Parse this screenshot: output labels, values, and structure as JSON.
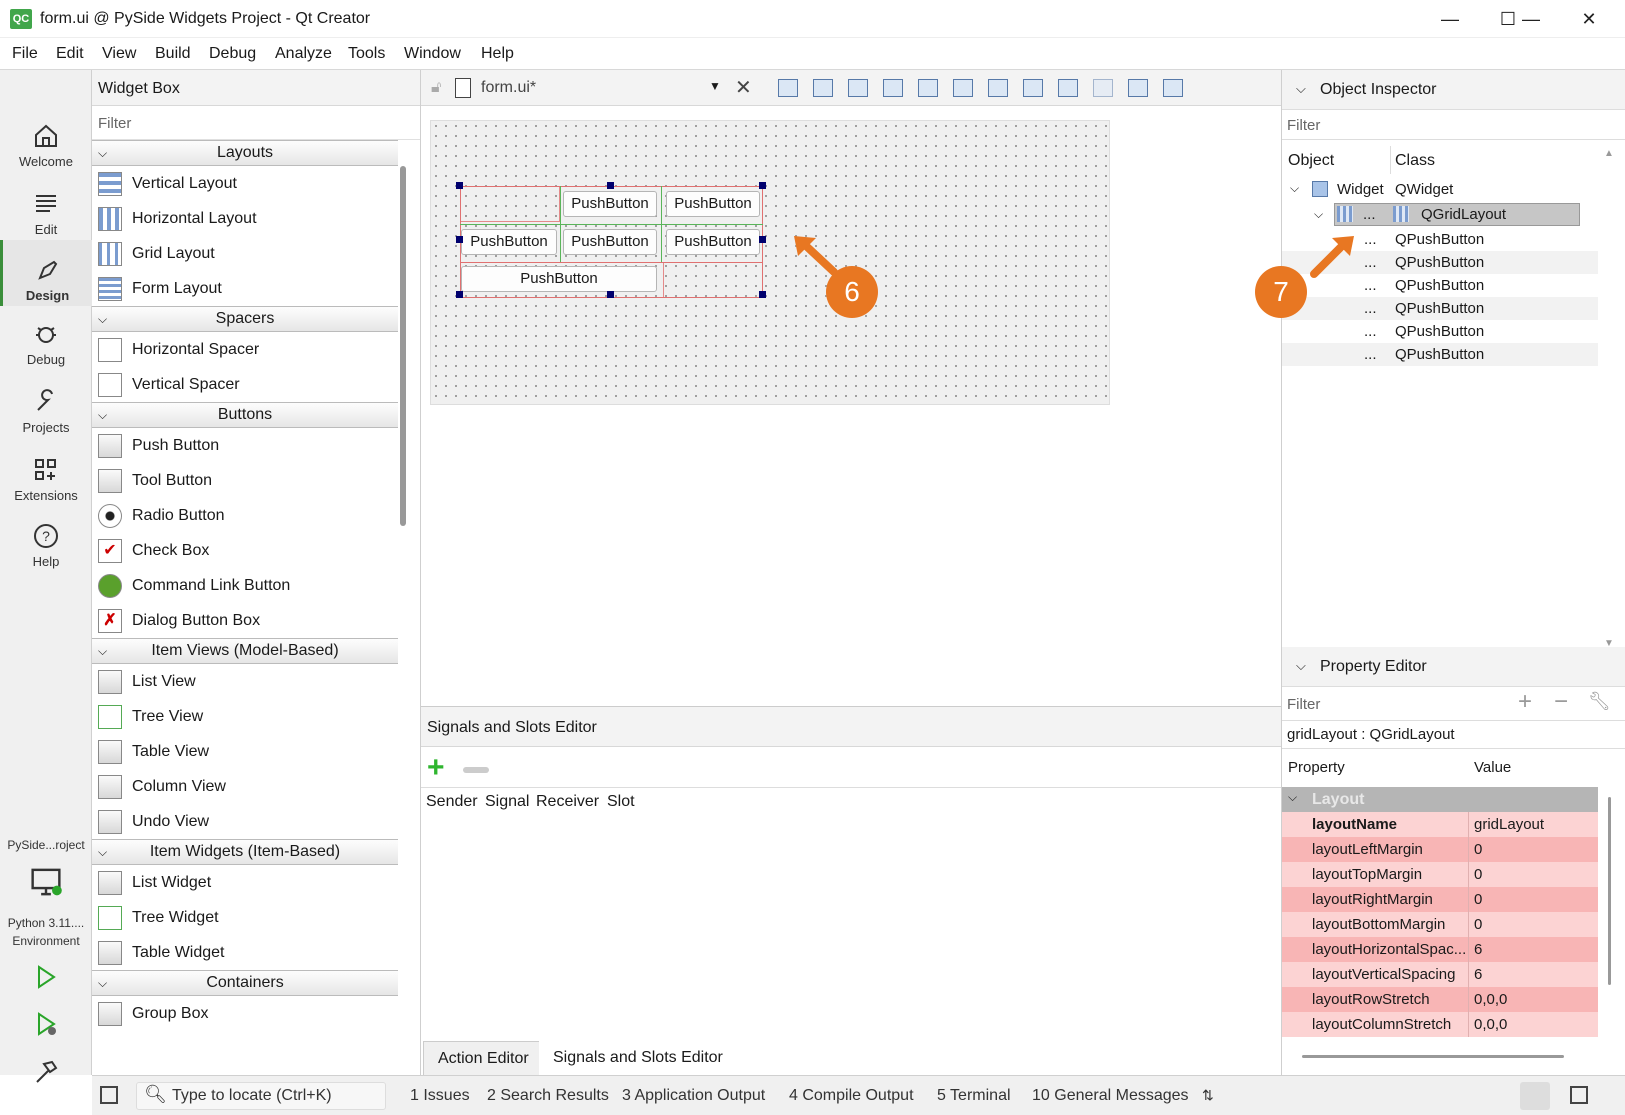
{
  "window": {
    "title": "form.ui @ PySide Widgets Project - Qt Creator",
    "logo": "QC",
    "minimize": "—",
    "maximize": "☐",
    "close": "✕"
  },
  "menu": [
    "File",
    "Edit",
    "View",
    "Build",
    "Debug",
    "Analyze",
    "Tools",
    "Window",
    "Help"
  ],
  "modes": {
    "welcome": "Welcome",
    "edit": "Edit",
    "design": "Design",
    "debug": "Debug",
    "projects": "Projects",
    "extensions": "Extensions",
    "help": "Help",
    "project_short": "PySide...roject",
    "env_line1": "Python 3.11....",
    "env_line2": "Environment"
  },
  "widget_box": {
    "title": "Widget Box",
    "filter": "Filter",
    "categories": [
      {
        "name": "Layouts",
        "items": [
          "Vertical Layout",
          "Horizontal Layout",
          "Grid Layout",
          "Form Layout"
        ]
      },
      {
        "name": "Spacers",
        "items": [
          "Horizontal Spacer",
          "Vertical Spacer"
        ]
      },
      {
        "name": "Buttons",
        "items": [
          "Push Button",
          "Tool Button",
          "Radio Button",
          "Check Box",
          "Command Link Button",
          "Dialog Button Box"
        ]
      },
      {
        "name": "Item Views (Model-Based)",
        "items": [
          "List View",
          "Tree View",
          "Table View",
          "Column View",
          "Undo View"
        ]
      },
      {
        "name": "Item Widgets (Item-Based)",
        "items": [
          "List Widget",
          "Tree Widget",
          "Table Widget"
        ]
      },
      {
        "name": "Containers",
        "items": [
          "Group Box"
        ]
      }
    ]
  },
  "editor": {
    "file": "form.ui*",
    "buttons": [
      "PushButton",
      "PushButton",
      "PushButton",
      "PushButton",
      "PushButton",
      "PushButton"
    ],
    "callout6": "6",
    "callout7": "7"
  },
  "signals": {
    "title": "Signals and Slots Editor",
    "columns": [
      "Sender",
      "Signal",
      "Receiver",
      "Slot"
    ],
    "tab_action": "Action Editor",
    "tab_signals": "Signals and Slots Editor"
  },
  "object_inspector": {
    "title": "Object Inspector",
    "filter": "Filter",
    "col_object": "Object",
    "col_class": "Class",
    "root_object": "Widget",
    "root_class": "QWidget",
    "layout_object": "...",
    "layout_class": "QGridLayout",
    "children": [
      {
        "object": "...",
        "class": "QPushButton"
      },
      {
        "object": "...",
        "class": "QPushButton"
      },
      {
        "object": "...",
        "class": "QPushButton"
      },
      {
        "object": "...",
        "class": "QPushButton"
      },
      {
        "object": "...",
        "class": "QPushButton"
      },
      {
        "object": "...",
        "class": "QPushButton"
      }
    ]
  },
  "property_editor": {
    "title": "Property Editor",
    "filter": "Filter",
    "current": "gridLayout : QGridLayout",
    "col_property": "Property",
    "col_value": "Value",
    "group": "Layout",
    "rows": [
      {
        "name": "layoutName",
        "value": "gridLayout"
      },
      {
        "name": "layoutLeftMargin",
        "value": "0"
      },
      {
        "name": "layoutTopMargin",
        "value": "0"
      },
      {
        "name": "layoutRightMargin",
        "value": "0"
      },
      {
        "name": "layoutBottomMargin",
        "value": "0"
      },
      {
        "name": "layoutHorizontalSpac...",
        "value": "6"
      },
      {
        "name": "layoutVerticalSpacing",
        "value": "6"
      },
      {
        "name": "layoutRowStretch",
        "value": "0,0,0"
      },
      {
        "name": "layoutColumnStretch",
        "value": "0,0,0"
      }
    ]
  },
  "statusbar": {
    "locate": "Type to locate (Ctrl+K)",
    "panes": [
      "1  Issues",
      "2  Search Results",
      "3  Application Output",
      "4  Compile Output",
      "5  Terminal",
      "10  General Messages"
    ]
  }
}
